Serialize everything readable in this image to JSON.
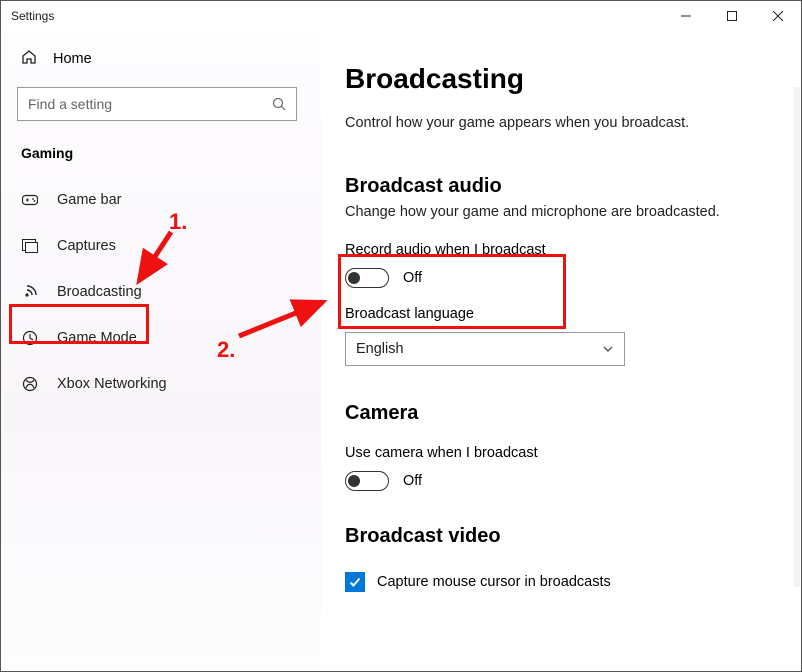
{
  "window": {
    "title": "Settings"
  },
  "titlebar": {
    "minimize": "min",
    "maximize": "max",
    "close": "close"
  },
  "sidebar": {
    "home": "Home",
    "search_placeholder": "Find a setting",
    "category": "Gaming",
    "items": [
      {
        "label": "Game bar"
      },
      {
        "label": "Captures"
      },
      {
        "label": "Broadcasting",
        "selected": true
      },
      {
        "label": "Game Mode"
      },
      {
        "label": "Xbox Networking"
      }
    ]
  },
  "page": {
    "title": "Broadcasting",
    "description": "Control how your game appears when you broadcast."
  },
  "sections": {
    "audio": {
      "title": "Broadcast audio",
      "description": "Change how your game and microphone are broadcasted.",
      "record_label": "Record audio when I broadcast",
      "record_state": "Off",
      "language_label": "Broadcast language",
      "language_value": "English"
    },
    "camera": {
      "title": "Camera",
      "use_label": "Use camera when I broadcast",
      "use_state": "Off"
    },
    "video": {
      "title": "Broadcast video",
      "cursor_label": "Capture mouse cursor in broadcasts",
      "cursor_checked": true
    }
  },
  "annotations": {
    "step1": "1.",
    "step2": "2."
  }
}
